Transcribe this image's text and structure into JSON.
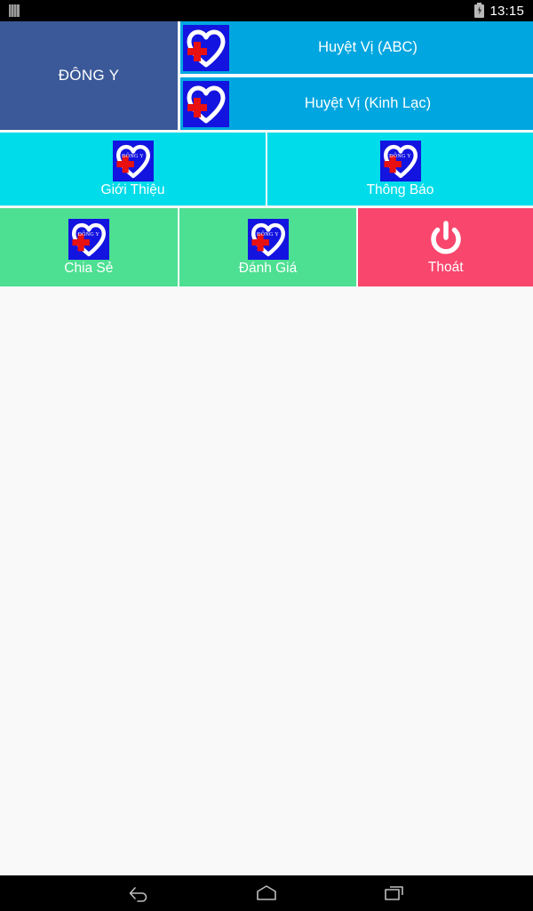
{
  "status_bar": {
    "sim_icon": "sim-card-icon",
    "battery_icon": "battery-charging-icon",
    "time": "13:15"
  },
  "colors": {
    "brand_tile": "#3b5998",
    "wide_tile": "#00a6e0",
    "cyan_tile": "#00dcea",
    "green_tile": "#4ddf92",
    "exit_tile": "#f9466d",
    "logo_background": "#1414e0",
    "logo_cross": "#e81010",
    "page_background": "#f9f9f9",
    "label_text": "#ffffff"
  },
  "menu": {
    "brand_tile": {
      "label": "ĐÔNG Y"
    },
    "wide_tiles": [
      {
        "label": "Huyệt Vị (ABC)",
        "icon": "heart-cross-logo-icon"
      },
      {
        "label": "Huyệt Vị (Kinh Lạc)",
        "icon": "heart-cross-logo-icon"
      }
    ],
    "cyan_tiles": [
      {
        "label": "Giới Thiệu",
        "icon": "heart-cross-logo-icon",
        "logo_word": "ĐÔNG Y"
      },
      {
        "label": "Thông Báo",
        "icon": "heart-cross-logo-icon",
        "logo_word": "ĐÔNG Y"
      }
    ],
    "green_tiles": [
      {
        "label": "Chia Sẻ",
        "icon": "heart-cross-logo-icon",
        "logo_word": "ĐÔNG Y"
      },
      {
        "label": "Đánh Giá",
        "icon": "heart-cross-logo-icon",
        "logo_word": "ĐÔNG Y"
      }
    ],
    "exit_tile": {
      "label": "Thoát",
      "icon": "power-icon"
    }
  },
  "nav_bar": {
    "back": "back-icon",
    "home": "home-icon",
    "recents": "recents-icon"
  }
}
